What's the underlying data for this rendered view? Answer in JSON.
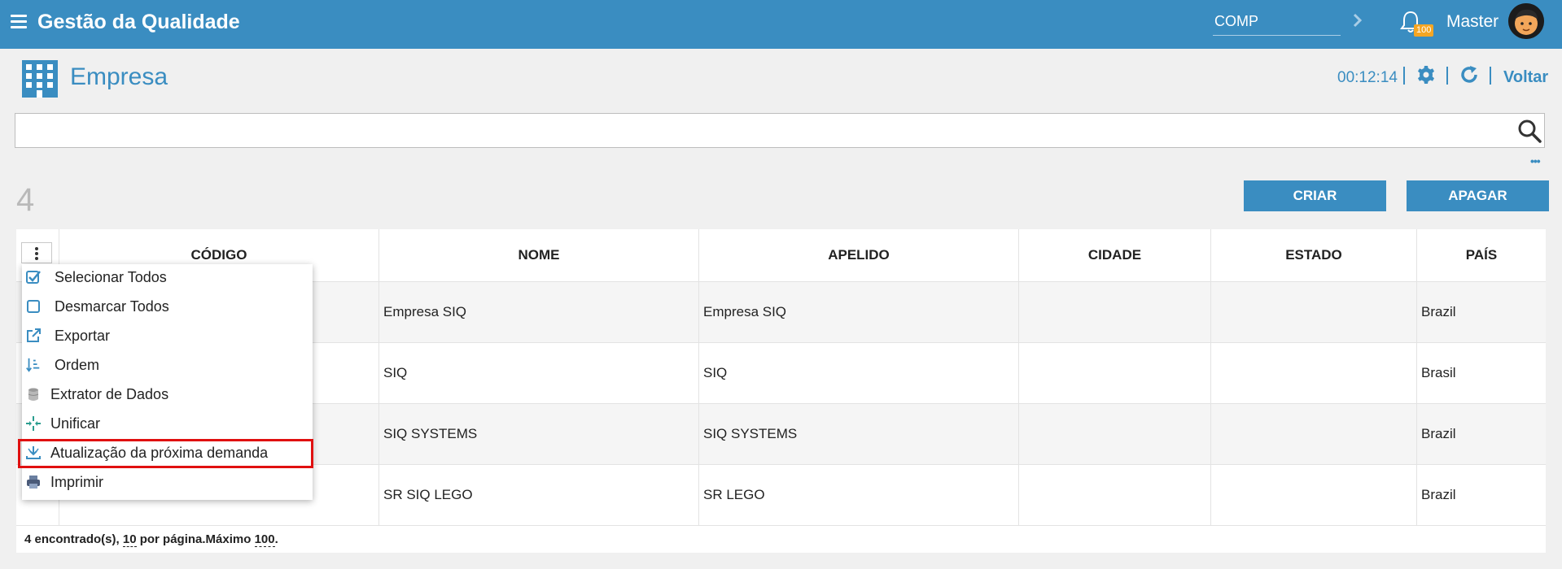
{
  "header": {
    "app_title": "Gestão da Qualidade",
    "company_value": "COMP",
    "notification_count": "100",
    "username": "Master",
    "accent_color": "#3a8dc1"
  },
  "page": {
    "title": "Empresa",
    "timer": "00:12:14",
    "back_label": "Voltar"
  },
  "search": {
    "value": "",
    "placeholder": ""
  },
  "toolbar": {
    "record_count": "4",
    "create_label": "CRIAR",
    "delete_label": "APAGAR"
  },
  "table": {
    "columns": [
      "CÓDIGO",
      "NOME",
      "APELIDO",
      "CIDADE",
      "ESTADO",
      "PAÍS"
    ],
    "rows": [
      {
        "codigo": "",
        "nome": "Empresa SIQ",
        "apelido": "Empresa SIQ",
        "cidade": "",
        "estado": "",
        "pais": "Brazil"
      },
      {
        "codigo": "",
        "nome": "SIQ",
        "apelido": "SIQ",
        "cidade": "",
        "estado": "",
        "pais": "Brasil"
      },
      {
        "codigo": "",
        "nome": "SIQ SYSTEMS",
        "apelido": "SIQ SYSTEMS",
        "cidade": "",
        "estado": "",
        "pais": "Brazil"
      },
      {
        "codigo": "",
        "nome": "SR SIQ LEGO",
        "apelido": "SR LEGO",
        "cidade": "",
        "estado": "",
        "pais": "Brazil"
      }
    ]
  },
  "footer": {
    "found_text": "4 encontrado(s), ",
    "per_page": "10",
    "per_page_text": " por página.Máximo ",
    "max": "100",
    "end": "."
  },
  "menu": {
    "items": [
      {
        "label": "Selecionar Todos",
        "icon": "check-square-icon"
      },
      {
        "label": "Desmarcar Todos",
        "icon": "square-icon"
      },
      {
        "label": "Exportar",
        "icon": "external-link-icon"
      },
      {
        "label": "Ordem",
        "icon": "sort-icon"
      },
      {
        "label": "Extrator de Dados",
        "icon": "database-icon"
      },
      {
        "label": "Unificar",
        "icon": "merge-icon"
      },
      {
        "label": "Atualização da próxima demanda",
        "icon": "download-update-icon"
      },
      {
        "label": "Imprimir",
        "icon": "printer-icon"
      }
    ]
  }
}
